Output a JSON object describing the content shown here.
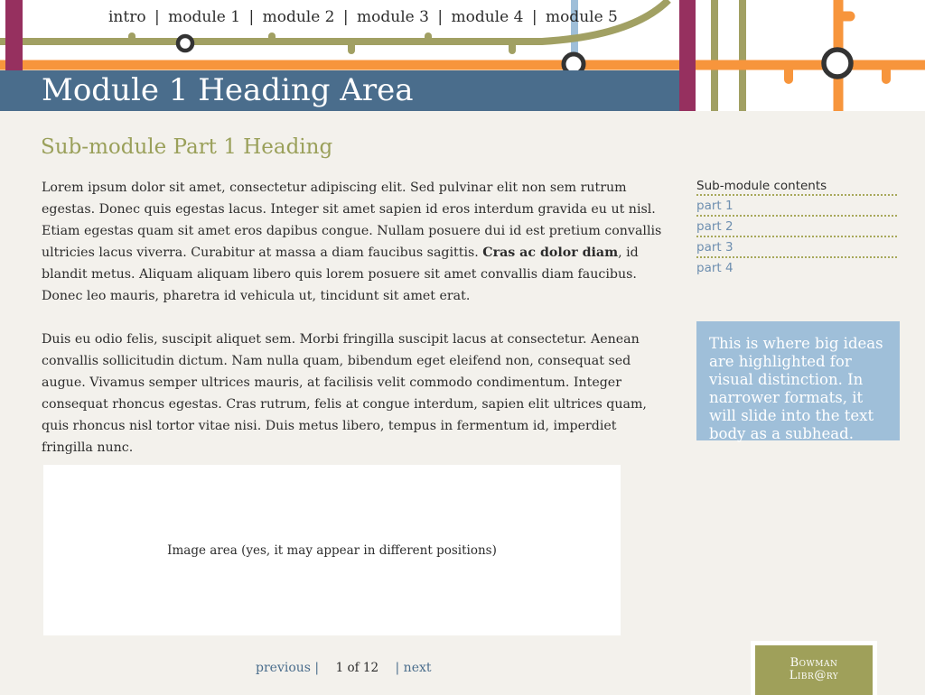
{
  "nav": {
    "items": [
      "intro",
      "module 1",
      "module 2",
      "module 3",
      "module 4",
      "module 5"
    ],
    "separator": "|"
  },
  "header": {
    "title": "Module 1 Heading Area"
  },
  "submodule": {
    "heading": "Sub-module Part 1 Heading"
  },
  "body": {
    "p1_a": "Lorem ipsum dolor sit amet, consectetur adipiscing elit. Sed pulvinar elit non sem rutrum egestas. Donec quis egestas lacus. Integer sit amet sapien id eros interdum gravida eu ut nisl. Etiam egestas quam sit amet eros dapibus congue. Nullam posuere dui id est pretium convallis ultricies lacus viverra. Curabitur at massa a diam faucibus sagittis. ",
    "p1_bold": "Cras ac dolor diam",
    "p1_b": ", id blandit metus. Aliquam aliquam libero quis lorem posuere sit amet convallis diam faucibus. Donec leo mauris, pharetra id vehicula ut, tincidunt sit amet erat.",
    "p2": "Duis eu odio felis, suscipit aliquet sem. Morbi fringilla suscipit lacus at consectetur. Aenean convallis sollicitudin dictum. Nam nulla quam, bibendum eget eleifend non, consequat sed augue. Vivamus semper ultrices mauris, at facilisis velit commodo condimentum. Integer consequat rhoncus egestas. Cras rutrum, felis at congue interdum, sapien elit ultrices quam, quis rhoncus nisl tortor vitae nisi. Duis metus libero, tempus in fermentum id, imperdiet fringilla nunc."
  },
  "sidebar": {
    "title": "Sub-module contents",
    "items": [
      "part 1",
      "part 2",
      "part 3",
      "part 4"
    ]
  },
  "callout": {
    "text": "This is where big ideas are highlighted for visual distinction. In narrower formats, it will slide into the text body as a subhead."
  },
  "image_area": {
    "text": "Image area (yes, it may appear in different positions)"
  },
  "pager": {
    "previous": "previous |",
    "count": "1 of 12",
    "next": "| next"
  },
  "logo": {
    "line1": "Bowman",
    "line2": "Libr@ry"
  },
  "colors": {
    "heading_bar": "#4a6d8c",
    "subhead": "#9aa05a",
    "orange_line": "#f7953c",
    "olive_line": "#a1a063",
    "magenta_line": "#96305f",
    "light_blue_line": "#9fbfd9",
    "callout_bg": "#9fbfd9",
    "link": "#6e8fb0",
    "logo_bg": "#9fa05a",
    "page_bg": "#f3f1ec"
  }
}
